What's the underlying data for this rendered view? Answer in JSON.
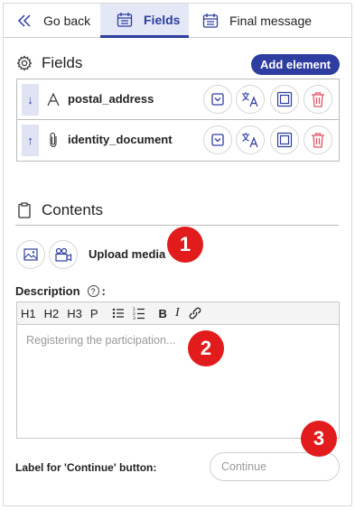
{
  "tabs": {
    "back_label": "Go back",
    "fields_label": "Fields",
    "final_label": "Final message"
  },
  "fields_section": {
    "title": "Fields",
    "add_button": "Add element",
    "rows": [
      {
        "handle_icon": "arrow-down-icon",
        "type_icon": "text-icon",
        "name": "postal_address"
      },
      {
        "handle_icon": "arrow-up-icon",
        "type_icon": "paperclip-icon",
        "name": "identity_document"
      }
    ],
    "row_actions": [
      "dropdown-icon",
      "translate-icon",
      "duplicate-icon",
      "trash-icon"
    ]
  },
  "contents_section": {
    "title": "Contents",
    "upload_label": "Upload media",
    "description_label": "Description",
    "description_suffix": ":",
    "toolbar": [
      "H1",
      "H2",
      "H3",
      "P"
    ],
    "editor_placeholder": "Registering the participation...",
    "continue_label": "Label for 'Continue' button:",
    "continue_placeholder": "Continue"
  },
  "markers": [
    "1",
    "2",
    "3"
  ],
  "colors": {
    "accent": "#2d3da0",
    "tab_active_bg": "#e3e7f6",
    "danger": "#e05563",
    "marker": "#e21c1c"
  }
}
